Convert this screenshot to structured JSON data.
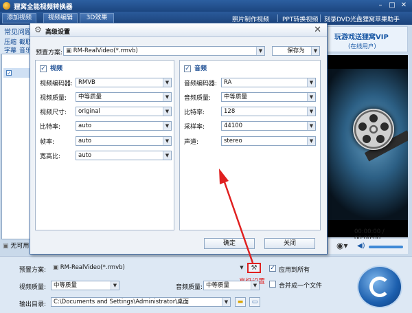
{
  "app": {
    "title": "狸窝全能视频转换器",
    "toolbar": {
      "add_video": "添加视频",
      "edit_video": "视频编辑",
      "effect_3d": "3D效果",
      "links": [
        "照片制作视频",
        "PPT转换视频",
        "刻录DVD光盘",
        "狸窝苹果助手"
      ]
    },
    "left_tabs": [
      "常见问题",
      "压缩",
      "截取",
      "字幕",
      "音乐"
    ],
    "left_bottom_label": "无可用",
    "promo": {
      "line1": "玩游戏送狸窝VIP",
      "line2": "(在线用户)"
    },
    "timecode": "00:00:00 / 00:00:00"
  },
  "dialog": {
    "title": "高级设置",
    "preset_label": "预置方案:",
    "preset_value": "RM-RealVideo(*.rmvb)",
    "save_as": "保存为",
    "video": {
      "heading": "视频",
      "rows": [
        {
          "label": "视频编码器:",
          "value": "RMVB"
        },
        {
          "label": "视频质量:",
          "value": "中等质量"
        },
        {
          "label": "视频尺寸:",
          "value": "original"
        },
        {
          "label": "比特率:",
          "value": "auto"
        },
        {
          "label": "帧率:",
          "value": "auto"
        },
        {
          "label": "宽高比:",
          "value": "auto"
        }
      ]
    },
    "audio": {
      "heading": "音频",
      "rows": [
        {
          "label": "音频编码器:",
          "value": "RA"
        },
        {
          "label": "音频质量:",
          "value": "中等质量"
        },
        {
          "label": "比特率:",
          "value": "128"
        },
        {
          "label": "采样率:",
          "value": "44100"
        },
        {
          "label": "声道:",
          "value": "stereo"
        }
      ]
    },
    "ok": "确定",
    "close": "关闭"
  },
  "bottom": {
    "preset_label": "预置方案:",
    "preset_value": "RM-RealVideo(*.rmvb)",
    "apply_all": "应用到所有",
    "merge_one": "合并成一个文件",
    "video_quality_label": "视频质量:",
    "video_quality_value": "中等质量",
    "audio_quality_label": "音频质量:",
    "audio_quality_value": "中等质量",
    "output_dir_label": "输出目录:",
    "output_dir_value": "C:\\Documents and Settings\\Administrator\\桌面",
    "annotation": "高级设置"
  },
  "colors": {
    "annotation_red": "#e02020",
    "title_blue": "#1c4680"
  }
}
